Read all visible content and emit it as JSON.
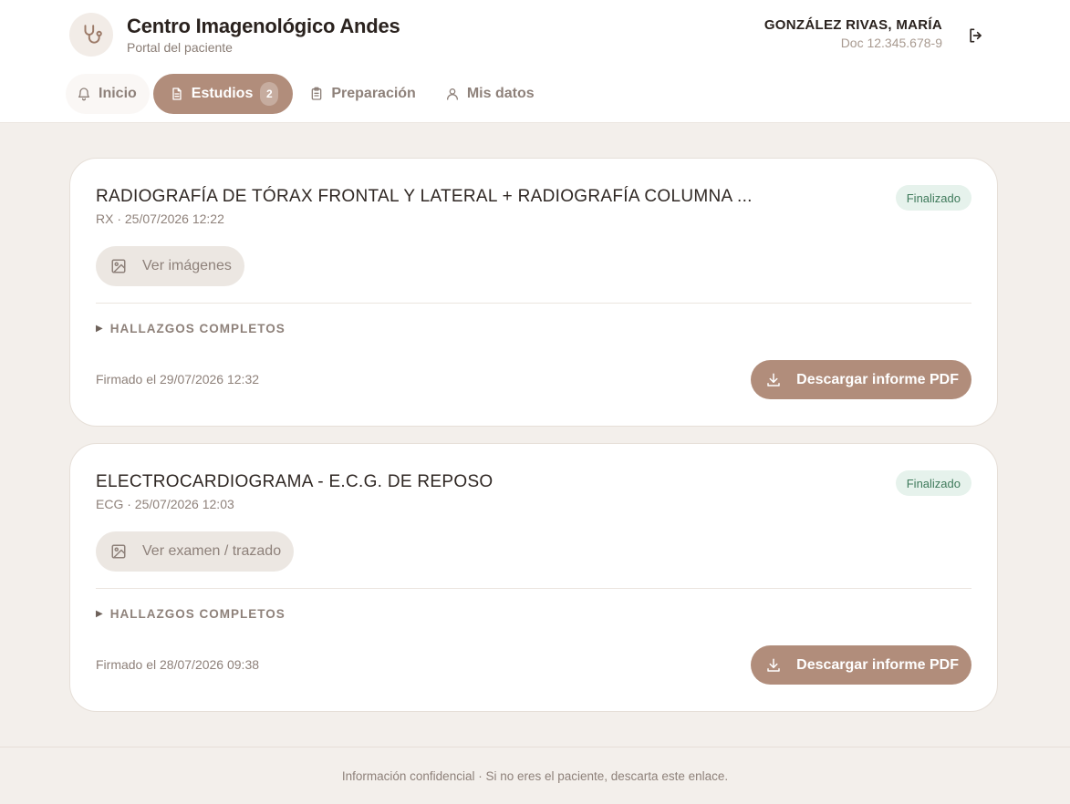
{
  "colors": {
    "accent": "#b18d7b",
    "page_background": "#f3efeb",
    "status_bg": "#e6f2ec",
    "status_text": "#3f7a5b"
  },
  "brand": {
    "icon": "stethoscope-icon",
    "title": "Centro Imagenológico Andes",
    "subtitle": "Portal del paciente"
  },
  "user": {
    "name": "GONZÁLEZ RIVAS, MARÍA",
    "doc": "Doc 12.345.678-9",
    "logout_icon": "logout-icon"
  },
  "tabs": [
    {
      "label": "Inicio",
      "icon": "bell-icon",
      "active": false
    },
    {
      "label": "Estudios",
      "icon": "document-icon",
      "active": true,
      "badge": "2"
    },
    {
      "label": "Preparación",
      "icon": "clipboard-icon",
      "active": false
    },
    {
      "label": "Mis datos",
      "icon": "user-icon",
      "active": false
    }
  ],
  "studies": [
    {
      "title": "RADIOGRAFÍA DE TÓRAX FRONTAL Y LATERAL + RADIOGRAFÍA COLUMNA ...",
      "meta": "RX · 25/07/2026 12:22",
      "status": "Finalizado",
      "view_label": "Ver imágenes",
      "findings_label": "HALLAZGOS COMPLETOS",
      "signed": "Firmado el 29/07/2026 12:32",
      "download_label": "Descargar informe PDF"
    },
    {
      "title": "ELECTROCARDIOGRAMA - E.C.G. DE REPOSO",
      "meta": "ECG · 25/07/2026 12:03",
      "status": "Finalizado",
      "view_label": "Ver examen / trazado",
      "findings_label": "HALLAZGOS COMPLETOS",
      "signed": "Firmado el 28/07/2026 09:38",
      "download_label": "Descargar informe PDF"
    }
  ],
  "footer": {
    "text": "Información confidencial · Si no eres el paciente, descarta este enlace."
  }
}
